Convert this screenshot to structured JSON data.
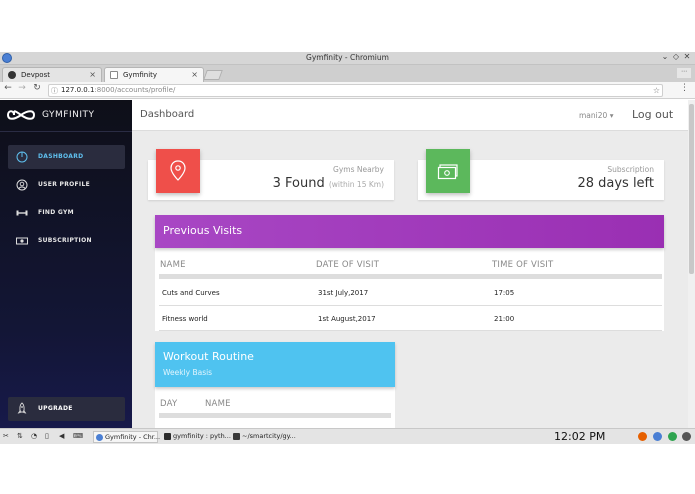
{
  "window": {
    "title": "Gymfinity - Chromium"
  },
  "tabs": [
    {
      "label": "Devpost",
      "icon": "devpost-icon",
      "active": false
    },
    {
      "label": "Gymfinity",
      "icon": "page-icon",
      "active": true
    }
  ],
  "address": {
    "host": "127.0.0.1",
    "rest": ":8000/accounts/profile/"
  },
  "brand": {
    "name": "GYMFINITY"
  },
  "sidebar": {
    "items": [
      {
        "label": "DASHBOARD",
        "icon": "dashboard-icon"
      },
      {
        "label": "USER PROFILE",
        "icon": "user-icon"
      },
      {
        "label": "FIND GYM",
        "icon": "dumbbell-icon"
      },
      {
        "label": "SUBSCRIPTION",
        "icon": "money-icon"
      }
    ],
    "upgrade": "UPGRADE"
  },
  "header": {
    "title": "Dashboard",
    "user": "mani20",
    "logout": "Log out"
  },
  "stats": {
    "gyms": {
      "label": "Gyms Nearby",
      "value": "3 Found",
      "sub": "(within 15 Km)",
      "color": "#ef4f4a"
    },
    "subscription": {
      "label": "Subscription",
      "value": "28 days left",
      "color": "#5cb85c"
    }
  },
  "visits": {
    "title": "Previous Visits",
    "headers": [
      "NAME",
      "DATE OF VISIT",
      "TIME OF VISIT"
    ],
    "rows": [
      [
        "Cuts and Curves",
        "31st July,2017",
        "17:05"
      ],
      [
        "Fitness world",
        "1st August,2017",
        "21:00"
      ]
    ]
  },
  "workout": {
    "title": "Workout Routine",
    "subtitle": "Weekly Basis",
    "headers": [
      "DAY",
      "NAME"
    ]
  },
  "taskbar": {
    "tasks": [
      "Gymfinity - Chr...",
      "gymfinity : pyth...",
      "~/smartcity/gy..."
    ],
    "clock": "12:02 PM"
  },
  "colors": {
    "accent": "#5fc0ef",
    "visits_header": "#a23cbf",
    "workout_header": "#4fc3f0"
  }
}
